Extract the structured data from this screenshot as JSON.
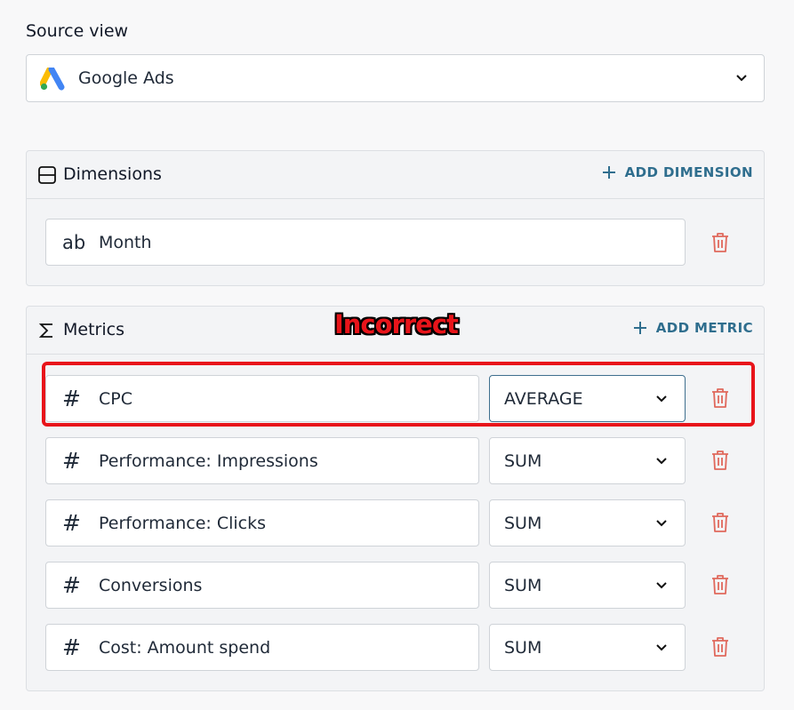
{
  "source": {
    "label": "Source view",
    "selected": "Google Ads",
    "icon": "google-ads-logo"
  },
  "dimensions": {
    "title": "Dimensions",
    "add_label": "ADD DIMENSION",
    "items": [
      {
        "icon": "ab",
        "label": "Month"
      }
    ]
  },
  "metrics": {
    "title": "Metrics",
    "add_label": "ADD METRIC",
    "items": [
      {
        "icon": "#",
        "label": "CPC",
        "aggregation": "AVERAGE"
      },
      {
        "icon": "#",
        "label": "Performance: Impressions",
        "aggregation": "SUM"
      },
      {
        "icon": "#",
        "label": "Performance: Clicks",
        "aggregation": "SUM"
      },
      {
        "icon": "#",
        "label": "Conversions",
        "aggregation": "SUM"
      },
      {
        "icon": "#",
        "label": "Cost: Amount spend",
        "aggregation": "SUM"
      }
    ]
  },
  "annotation": {
    "text": "Incorrect",
    "color": "#e8141a"
  },
  "colors": {
    "accent": "#2f6e8e",
    "delete": "#e0685c",
    "highlight": "#e8141a"
  }
}
